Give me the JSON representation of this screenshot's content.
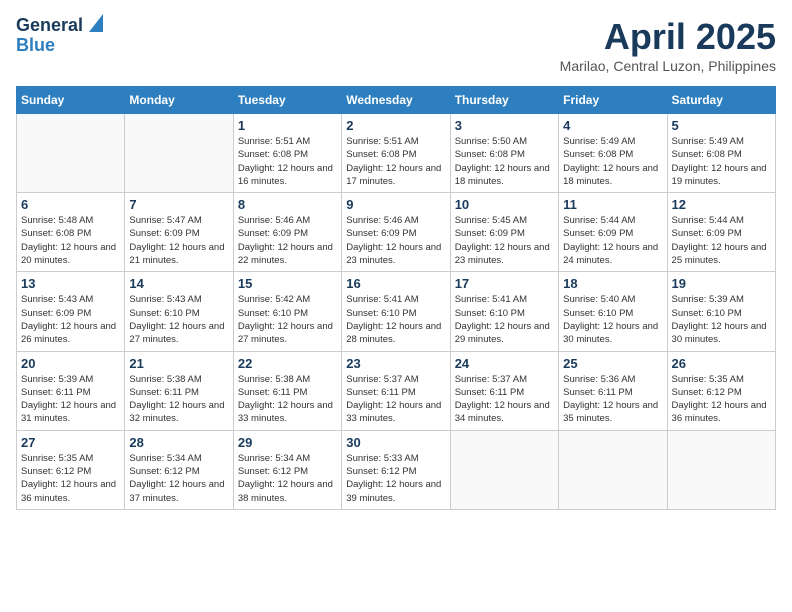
{
  "logo": {
    "line1": "General",
    "line2": "Blue"
  },
  "title": "April 2025",
  "location": "Marilao, Central Luzon, Philippines",
  "weekdays": [
    "Sunday",
    "Monday",
    "Tuesday",
    "Wednesday",
    "Thursday",
    "Friday",
    "Saturday"
  ],
  "weeks": [
    [
      {
        "day": "",
        "info": ""
      },
      {
        "day": "",
        "info": ""
      },
      {
        "day": "1",
        "info": "Sunrise: 5:51 AM\nSunset: 6:08 PM\nDaylight: 12 hours and 16 minutes."
      },
      {
        "day": "2",
        "info": "Sunrise: 5:51 AM\nSunset: 6:08 PM\nDaylight: 12 hours and 17 minutes."
      },
      {
        "day": "3",
        "info": "Sunrise: 5:50 AM\nSunset: 6:08 PM\nDaylight: 12 hours and 18 minutes."
      },
      {
        "day": "4",
        "info": "Sunrise: 5:49 AM\nSunset: 6:08 PM\nDaylight: 12 hours and 18 minutes."
      },
      {
        "day": "5",
        "info": "Sunrise: 5:49 AM\nSunset: 6:08 PM\nDaylight: 12 hours and 19 minutes."
      }
    ],
    [
      {
        "day": "6",
        "info": "Sunrise: 5:48 AM\nSunset: 6:08 PM\nDaylight: 12 hours and 20 minutes."
      },
      {
        "day": "7",
        "info": "Sunrise: 5:47 AM\nSunset: 6:09 PM\nDaylight: 12 hours and 21 minutes."
      },
      {
        "day": "8",
        "info": "Sunrise: 5:46 AM\nSunset: 6:09 PM\nDaylight: 12 hours and 22 minutes."
      },
      {
        "day": "9",
        "info": "Sunrise: 5:46 AM\nSunset: 6:09 PM\nDaylight: 12 hours and 23 minutes."
      },
      {
        "day": "10",
        "info": "Sunrise: 5:45 AM\nSunset: 6:09 PM\nDaylight: 12 hours and 23 minutes."
      },
      {
        "day": "11",
        "info": "Sunrise: 5:44 AM\nSunset: 6:09 PM\nDaylight: 12 hours and 24 minutes."
      },
      {
        "day": "12",
        "info": "Sunrise: 5:44 AM\nSunset: 6:09 PM\nDaylight: 12 hours and 25 minutes."
      }
    ],
    [
      {
        "day": "13",
        "info": "Sunrise: 5:43 AM\nSunset: 6:09 PM\nDaylight: 12 hours and 26 minutes."
      },
      {
        "day": "14",
        "info": "Sunrise: 5:43 AM\nSunset: 6:10 PM\nDaylight: 12 hours and 27 minutes."
      },
      {
        "day": "15",
        "info": "Sunrise: 5:42 AM\nSunset: 6:10 PM\nDaylight: 12 hours and 27 minutes."
      },
      {
        "day": "16",
        "info": "Sunrise: 5:41 AM\nSunset: 6:10 PM\nDaylight: 12 hours and 28 minutes."
      },
      {
        "day": "17",
        "info": "Sunrise: 5:41 AM\nSunset: 6:10 PM\nDaylight: 12 hours and 29 minutes."
      },
      {
        "day": "18",
        "info": "Sunrise: 5:40 AM\nSunset: 6:10 PM\nDaylight: 12 hours and 30 minutes."
      },
      {
        "day": "19",
        "info": "Sunrise: 5:39 AM\nSunset: 6:10 PM\nDaylight: 12 hours and 30 minutes."
      }
    ],
    [
      {
        "day": "20",
        "info": "Sunrise: 5:39 AM\nSunset: 6:11 PM\nDaylight: 12 hours and 31 minutes."
      },
      {
        "day": "21",
        "info": "Sunrise: 5:38 AM\nSunset: 6:11 PM\nDaylight: 12 hours and 32 minutes."
      },
      {
        "day": "22",
        "info": "Sunrise: 5:38 AM\nSunset: 6:11 PM\nDaylight: 12 hours and 33 minutes."
      },
      {
        "day": "23",
        "info": "Sunrise: 5:37 AM\nSunset: 6:11 PM\nDaylight: 12 hours and 33 minutes."
      },
      {
        "day": "24",
        "info": "Sunrise: 5:37 AM\nSunset: 6:11 PM\nDaylight: 12 hours and 34 minutes."
      },
      {
        "day": "25",
        "info": "Sunrise: 5:36 AM\nSunset: 6:11 PM\nDaylight: 12 hours and 35 minutes."
      },
      {
        "day": "26",
        "info": "Sunrise: 5:35 AM\nSunset: 6:12 PM\nDaylight: 12 hours and 36 minutes."
      }
    ],
    [
      {
        "day": "27",
        "info": "Sunrise: 5:35 AM\nSunset: 6:12 PM\nDaylight: 12 hours and 36 minutes."
      },
      {
        "day": "28",
        "info": "Sunrise: 5:34 AM\nSunset: 6:12 PM\nDaylight: 12 hours and 37 minutes."
      },
      {
        "day": "29",
        "info": "Sunrise: 5:34 AM\nSunset: 6:12 PM\nDaylight: 12 hours and 38 minutes."
      },
      {
        "day": "30",
        "info": "Sunrise: 5:33 AM\nSunset: 6:12 PM\nDaylight: 12 hours and 39 minutes."
      },
      {
        "day": "",
        "info": ""
      },
      {
        "day": "",
        "info": ""
      },
      {
        "day": "",
        "info": ""
      }
    ]
  ]
}
